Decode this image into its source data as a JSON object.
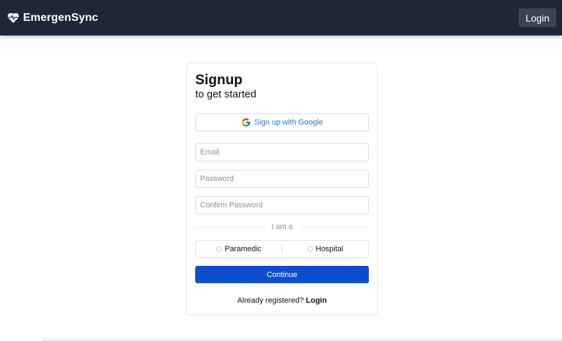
{
  "header": {
    "brand_name": "EmergenSync",
    "brand_icon": "heart-pulse-icon",
    "login_label": "Login",
    "background": "#1e2735"
  },
  "signup": {
    "title": "Signup",
    "subtitle": "to get started",
    "google_label": "Sign up with Google",
    "email_placeholder": "Email",
    "password_placeholder": "Password",
    "confirm_placeholder": "Confirm Password",
    "role_divider": "I am a",
    "roles": [
      {
        "label": "Paramedic",
        "selected": false
      },
      {
        "label": "Hospital",
        "selected": false
      }
    ],
    "continue_label": "Continue",
    "footer_text": "Already registered?",
    "footer_link": "Login",
    "accent": "#0b4fcf"
  }
}
